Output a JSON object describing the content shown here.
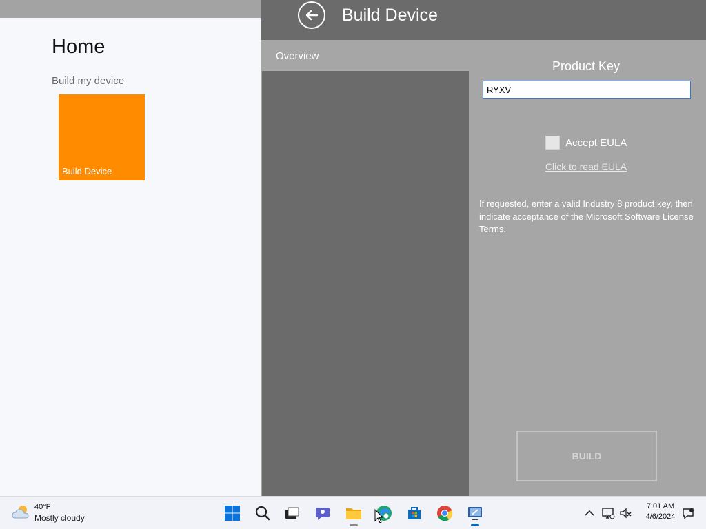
{
  "home": {
    "title": "Home",
    "subtitle": "Build my device",
    "tile_label": "Build Device",
    "tile_color": "#ff8c00"
  },
  "build": {
    "header_title": "Build Device",
    "tab_overview": "Overview",
    "product_key_label": "Product Key",
    "product_key_value": "RYXV",
    "accept_eula_label": "Accept EULA",
    "accept_eula_checked": false,
    "read_eula_link": "Click to read EULA",
    "help_text": "If requested, enter a valid Industry 8 product key, then indicate acceptance of the Microsoft Software License Terms.",
    "build_button": "BUILD"
  },
  "taskbar": {
    "weather_temp": "40°F",
    "weather_desc": "Mostly cloudy",
    "icons": [
      "windows-start-icon",
      "search-icon",
      "task-view-icon",
      "chat-icon",
      "file-explorer-icon",
      "edge-icon",
      "store-icon",
      "chrome-icon",
      "device-builder-app-icon"
    ],
    "tray_icons": [
      "chevron-up-icon",
      "network-icon",
      "volume-muted-icon",
      "notification-icon"
    ],
    "time": "7:01 AM",
    "date": "4/6/2024"
  }
}
